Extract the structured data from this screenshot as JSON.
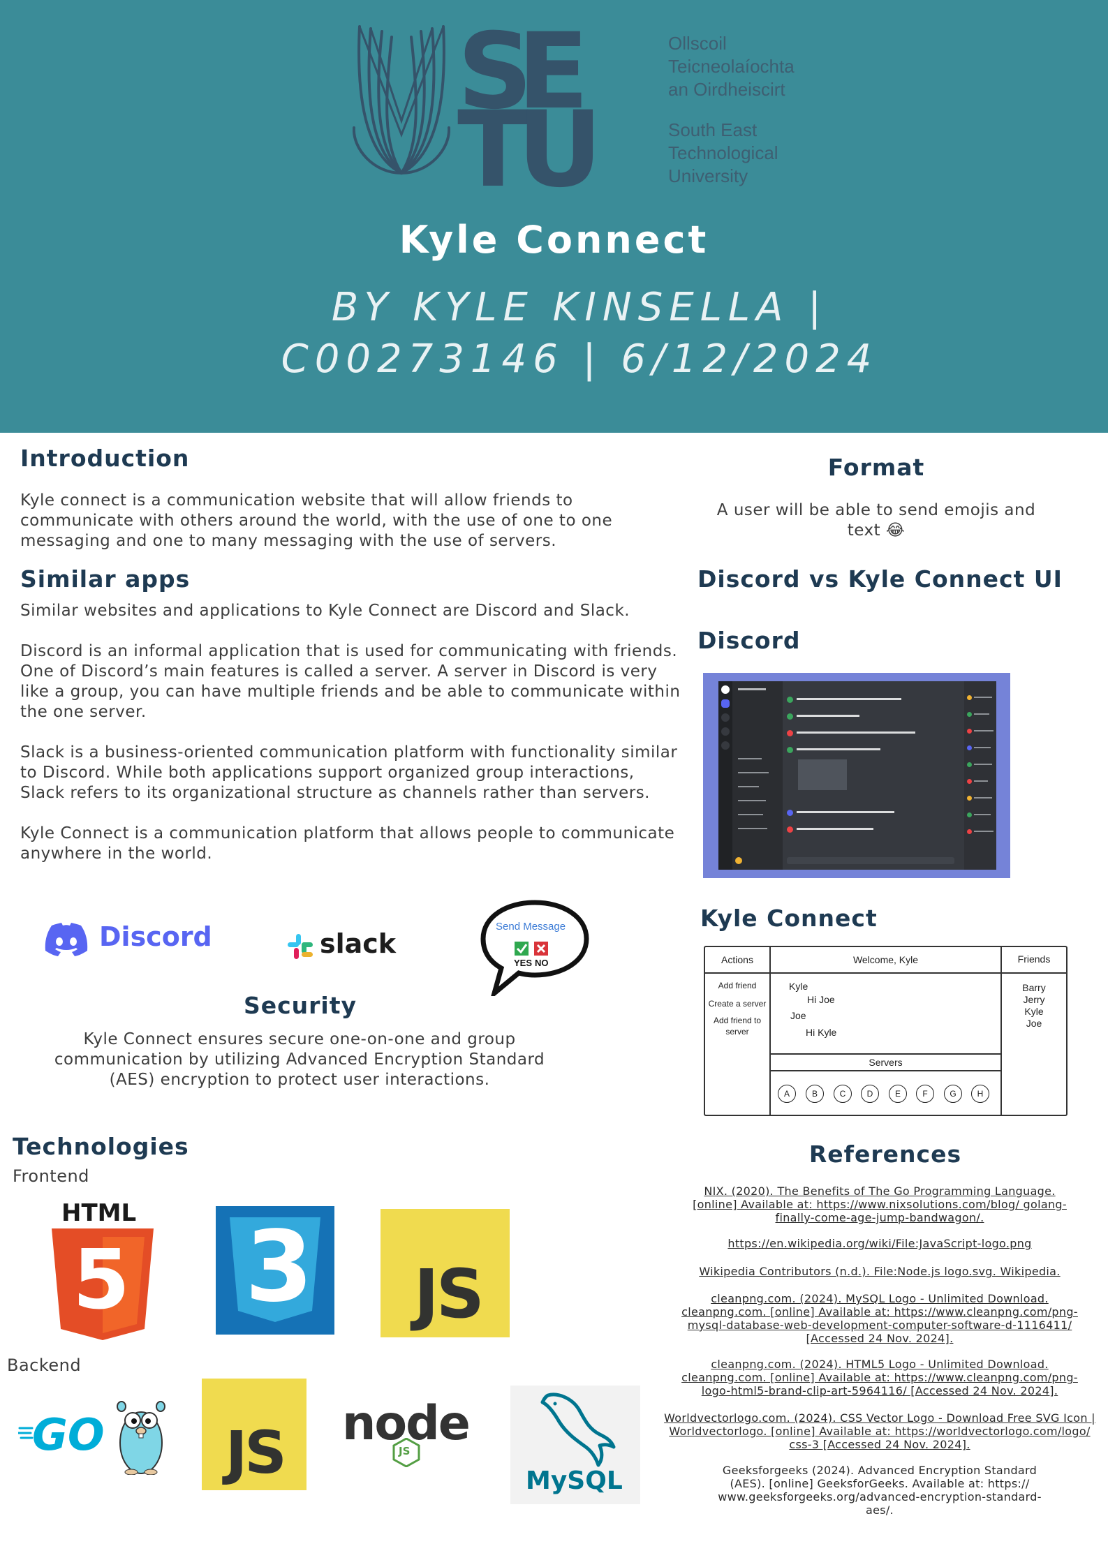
{
  "header": {
    "logo": {
      "letters": [
        "S",
        "E",
        "T",
        "U"
      ],
      "irish_name_lines": [
        "Ollscoil",
        "Teicneolaíochta",
        "an Oirdheiscirt"
      ],
      "english_name_lines": [
        "South East",
        "Technological",
        "University"
      ]
    },
    "title": "Kyle Connect",
    "subtitle_line1": "BY KYLE KINSELLA |",
    "subtitle_line2": "C00273146 | 6/12/2024"
  },
  "introduction": {
    "heading": "Introduction",
    "text": "Kyle connect is a communication website that will allow friends to communicate with others around the world, with the use of one to one messaging and one to many messaging with the use of servers."
  },
  "similar_apps": {
    "heading": "Similar apps",
    "p1": "Similar websites and applications to Kyle Connect are Discord and Slack.",
    "p2": "Discord is an informal application that is used for communicating with friends. One of Discord’s main features is called a server. A server in Discord is very like a group, you can have multiple friends and be able to communicate within the one server.",
    "p3": "Slack is a business-oriented communication platform with functionality similar to Discord. While both applications support organized group interactions, Slack refers to its organizational structure as channels rather than servers.",
    "p4": "Kyle Connect is a communication platform that allows people to communicate anywhere in the world."
  },
  "app_logos": {
    "discord": "Discord",
    "slack": "slack",
    "kyle_bubble_label": "Send Message",
    "kyle_bubble_yes": "YES",
    "kyle_bubble_no": "NO"
  },
  "security": {
    "heading": "Security",
    "text": "Kyle Connect ensures secure one-on-one and group communication by utilizing Advanced Encryption Standard (AES) encryption to protect user interactions."
  },
  "technologies": {
    "heading": "Technologies",
    "frontend_label": "Frontend",
    "backend_label": "Backend",
    "html_label": "HTML",
    "html_number": "5",
    "css_number": "3",
    "js_label": "JS",
    "go_label": "GO",
    "node_label": "node",
    "node_sub": "JS",
    "mysql_label": "MySQL"
  },
  "format": {
    "heading": "Format",
    "text": "A user will be able to send emojis and text 😂"
  },
  "ui_compare": {
    "heading": "Discord vs Kyle Connect UI",
    "discord_heading": "Discord",
    "kyle_heading": "Kyle Connect"
  },
  "wireframe": {
    "actions_header": "Actions",
    "welcome_header": "Welcome, Kyle",
    "friends_header": "Friends",
    "actions": [
      "Add friend",
      "Create a server",
      "Add friend to",
      "server"
    ],
    "messages": [
      "Kyle",
      "Hi Joe",
      "Joe",
      "Hi Kyle"
    ],
    "friends": [
      "Barry",
      "Jerry",
      "Kyle",
      "Joe"
    ],
    "servers_label": "Servers",
    "servers": [
      "A",
      "B",
      "C",
      "D",
      "E",
      "F",
      "G",
      "H"
    ]
  },
  "references": {
    "heading": "References",
    "items": [
      "NIX. (2020). The Benefits of The Go Programming Language. [online] Available at: https://www.nixsolutions.com/blog/ golang-finally-come-age-jump-bandwagon/.",
      "https://en.wikipedia.org/wiki/File:JavaScript-logo.png",
      "Wikipedia Contributors (n.d.). File:Node.js logo.svg. Wikipedia.",
      "cleanpng.com. (2024). MySQL Logo - Unlimited Download. cleanpng.com. [online] Available at: https://www.cleanpng.com/png-mysql-database-web-development-computer-software-d-1116411/ [Accessed 24 Nov. 2024].",
      "cleanpng.com. (2024). HTML5 Logo - Unlimited Download. cleanpng.com. [online] Available at: https://www.cleanpng.com/png-logo-html5-brand-clip-art-5964116/ [Accessed 24 Nov. 2024].",
      "Worldvectorlogo.com. (2024). CSS Vector Logo - Download Free SVG Icon | Worldvectorlogo. [online] Available at: https://worldvectorlogo.com/logo/ css-3 [Accessed 24 Nov. 2024].",
      "Geeksforgeeks (2024). Advanced Encryption Standard (AES). [online] GeeksforGeeks. Available at: https:// www.geeksforgeeks.org/advanced-encryption-standard-aes/."
    ]
  },
  "colors": {
    "header_bg": "#3b8c98",
    "heading": "#1e3a52",
    "logo": "#35536a",
    "discord_blurple": "#5865f2",
    "html_orange": "#e44d26",
    "css_blue": "#1572b6",
    "js_yellow": "#f0db4f",
    "go_cyan": "#00add8",
    "node_green": "#539e43",
    "mysql_blue": "#00758f",
    "mysql_orange": "#f29111"
  }
}
